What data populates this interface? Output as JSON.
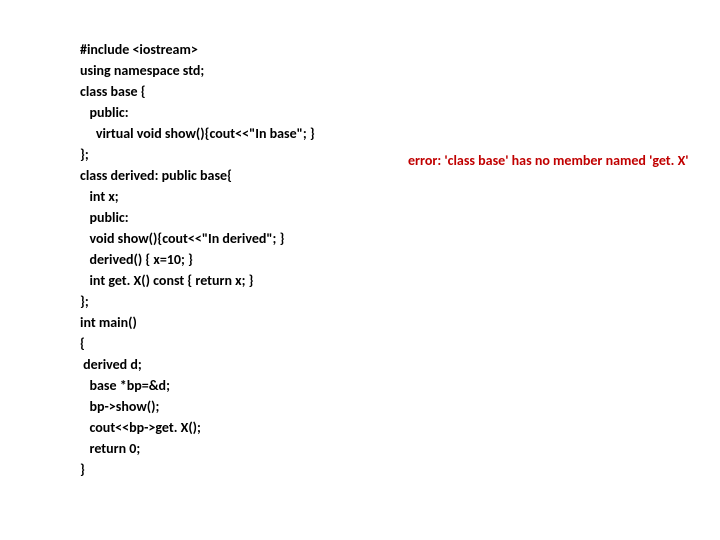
{
  "code": {
    "l1": "#include <iostream>",
    "l2": "using namespace std;",
    "l3": "class base {",
    "l4": "   public:",
    "l5": "     virtual void show(){cout<<\"In base\"; }",
    "l6": "};",
    "l7": "class derived: public base{",
    "l8": "   int x;",
    "l9": "   public:",
    "l10": "   void show(){cout<<\"In derived\"; }",
    "l11": "   derived() { x=10; }",
    "l12": "   int get. X() const { return x; }",
    "l13": "};",
    "l14": "int main()",
    "l15": "{",
    "l16": " derived d;",
    "l17": "   base *bp=&d;",
    "l18": "   bp->show();",
    "l19": "   cout<<bp->get. X();",
    "l20": "   return 0;",
    "l21": "}"
  },
  "error": "error: 'class base' has no member named 'get. X'"
}
